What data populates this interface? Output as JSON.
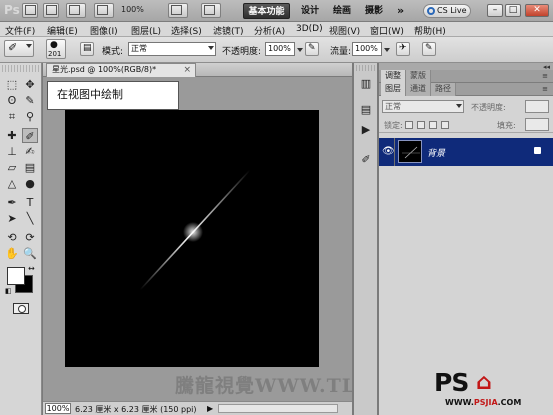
{
  "appbar": {
    "logo": "Ps",
    "zoom": "100%",
    "workspaces": [
      "基本功能",
      "设计",
      "绘画",
      "摄影"
    ],
    "more": "»",
    "cs_live": "CS Live",
    "window_controls": [
      "–",
      "□",
      "✕"
    ]
  },
  "menubar": {
    "items": [
      "文件(F)",
      "编辑(E)",
      "图像(I)",
      "图层(L)",
      "选择(S)",
      "滤镜(T)",
      "分析(A)",
      "3D(D)",
      "视图(V)",
      "窗口(W)",
      "帮助(H)"
    ]
  },
  "options": {
    "brush_size": "201",
    "mode_label": "模式:",
    "mode_value": "正常",
    "opacity_label": "不透明度:",
    "opacity_value": "100%",
    "flow_label": "流量:",
    "flow_value": "100%"
  },
  "toolbox": {
    "tools": [
      {
        "name": "marquee-tool-icon",
        "glyph": "⬚"
      },
      {
        "name": "move-tool-icon",
        "glyph": "✥"
      },
      {
        "name": "lasso-tool-icon",
        "glyph": "ʘ"
      },
      {
        "name": "quick-select-tool-icon",
        "glyph": "✎"
      },
      {
        "name": "crop-tool-icon",
        "glyph": "⌗"
      },
      {
        "name": "eyedropper-tool-icon",
        "glyph": "⚲"
      },
      {
        "name": "healing-tool-icon",
        "glyph": "✚"
      },
      {
        "name": "brush-tool-icon",
        "glyph": "✐"
      },
      {
        "name": "stamp-tool-icon",
        "glyph": "⊥"
      },
      {
        "name": "history-brush-tool-icon",
        "glyph": "✍"
      },
      {
        "name": "eraser-tool-icon",
        "glyph": "▱"
      },
      {
        "name": "gradient-tool-icon",
        "glyph": "▤"
      },
      {
        "name": "blur-tool-icon",
        "glyph": "△"
      },
      {
        "name": "dodge-tool-icon",
        "glyph": "●"
      },
      {
        "name": "pen-tool-icon",
        "glyph": "✒"
      },
      {
        "name": "type-tool-icon",
        "glyph": "T"
      },
      {
        "name": "path-select-tool-icon",
        "glyph": "➤"
      },
      {
        "name": "shape-tool-icon",
        "glyph": "╲"
      },
      {
        "name": "3d-rotate-tool-icon",
        "glyph": "⟲"
      },
      {
        "name": "3d-orbit-tool-icon",
        "glyph": "⟳"
      },
      {
        "name": "hand-tool-icon",
        "glyph": "✋"
      },
      {
        "name": "zoom-tool-icon",
        "glyph": "🔍"
      }
    ],
    "active_tool": "brush-tool-icon",
    "foreground_color": "#ffffff",
    "background_color": "#000000"
  },
  "document": {
    "tab_title": "星光.psd @ 100%(RGB/8)",
    "tab_suffix": "*",
    "close": "×",
    "callout": "在视图中绘制",
    "watermark": "騰龍視覺WWW.TLV",
    "status_zoom": "100%",
    "status_info": "6.23 厘米 x 6.23 厘米 (150 ppi)",
    "status_arrow": "▶",
    "canvas_color": "#000000"
  },
  "panels": {
    "collapse": "◂◂",
    "top_tabs": [
      "调整",
      "蒙版"
    ],
    "layer_tabs": [
      "图层",
      "通道",
      "路径"
    ],
    "blend_mode": "正常",
    "opacity_label": "不透明度:",
    "lock_label": "锁定:",
    "fill_label": "填充:",
    "layer_name": "背景",
    "selected_color": "#0f2a7a"
  },
  "logo": {
    "main": "PS",
    "sub": "WWW.",
    "sub_red": "PSJIA",
    "sub_end": ".COM"
  }
}
